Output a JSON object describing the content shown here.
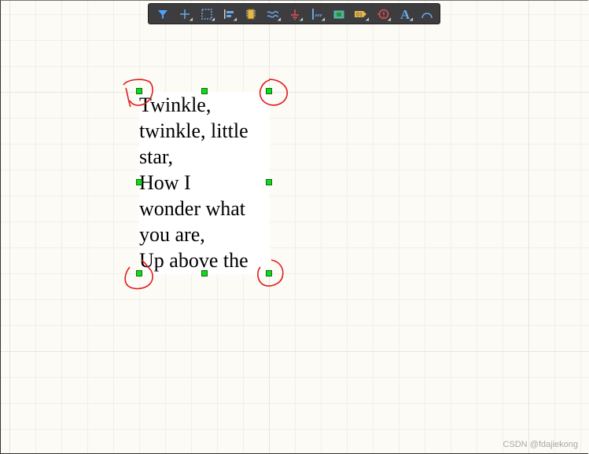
{
  "toolbar": {
    "buttons": [
      {
        "name": "filter-icon",
        "color": "#4ea3ff"
      },
      {
        "name": "crosshair-move-icon",
        "color": "#6aa8e8"
      },
      {
        "name": "select-rectangle-icon",
        "color": "#6aa8e8"
      },
      {
        "name": "align-icon",
        "color": "#6aa8e8"
      },
      {
        "name": "component-icon",
        "color": "#e6b84a"
      },
      {
        "name": "wire-icon",
        "color": "#6aa8e8"
      },
      {
        "name": "ground-power-icon",
        "color": "#e05050"
      },
      {
        "name": "bus-icon",
        "color": "#6aa8e8"
      },
      {
        "name": "sheet-symbol-icon",
        "color": "#3fbf6a"
      },
      {
        "name": "port-icon",
        "color": "#e6b84a",
        "label": "D1"
      },
      {
        "name": "directive-icon",
        "color": "#e05050"
      },
      {
        "name": "text-icon",
        "color": "#6aa8e8",
        "label": "A"
      },
      {
        "name": "arc-icon",
        "color": "#6aa8e8"
      }
    ]
  },
  "text_frame": {
    "content": "Twinkle,\ntwinkle, little\nstar,\nHow I\nwonder what\nyou are,\nUp above the"
  },
  "watermark": "CSDN @fdajiekong"
}
